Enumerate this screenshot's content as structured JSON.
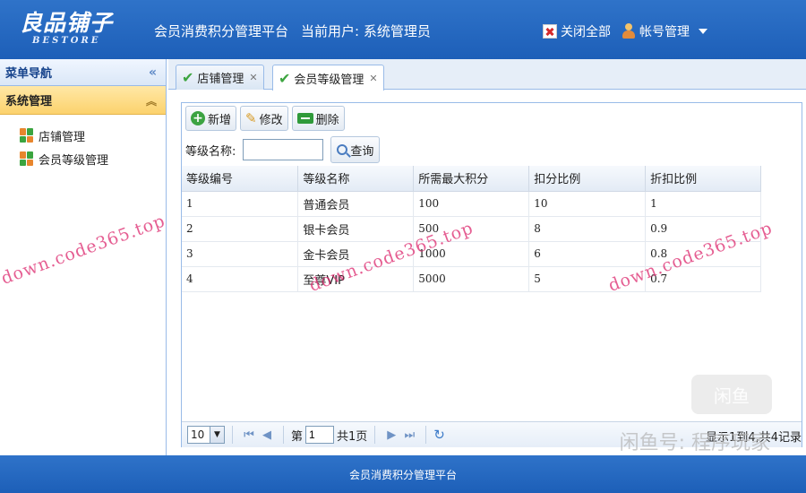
{
  "header": {
    "logo_main": "良品铺子",
    "logo_sub": "BESTORE",
    "title": "会员消费积分管理平台",
    "current_user": "当前用户: 系统管理员",
    "close_all": "关闭全部",
    "account": "帐号管理"
  },
  "sidebar": {
    "heading": "菜单导航",
    "section": "系统管理",
    "items": [
      {
        "label": "店铺管理"
      },
      {
        "label": "会员等级管理"
      }
    ]
  },
  "tabs": [
    {
      "label": "店铺管理"
    },
    {
      "label": "会员等级管理"
    }
  ],
  "toolbar": {
    "add": "新增",
    "edit": "修改",
    "delete": "删除"
  },
  "search": {
    "label": "等级名称:",
    "value": "",
    "button": "查询"
  },
  "table": {
    "columns": [
      "等级编号",
      "等级名称",
      "所需最大积分",
      "扣分比例",
      "折扣比例"
    ],
    "rows": [
      [
        "1",
        "普通会员",
        "100",
        "10",
        "1"
      ],
      [
        "2",
        "银卡会员",
        "500",
        "8",
        "0.9"
      ],
      [
        "3",
        "金卡会员",
        "1000",
        "6",
        "0.8"
      ],
      [
        "4",
        "至尊VIP",
        "5000",
        "5",
        "0.7"
      ]
    ]
  },
  "pager": {
    "page_size": "10",
    "page_prefix": "第",
    "page_value": "1",
    "page_suffix": "共1页",
    "info": "显示1到4,共4记录"
  },
  "watermarks": {
    "site1": "down.code365.top",
    "site2": "down.code365.top",
    "site3": "down.code365.top",
    "brand": "闲鱼号: 程序玩家",
    "logo": "闲鱼"
  },
  "footer": {
    "text": "会员消费积分管理平台"
  }
}
